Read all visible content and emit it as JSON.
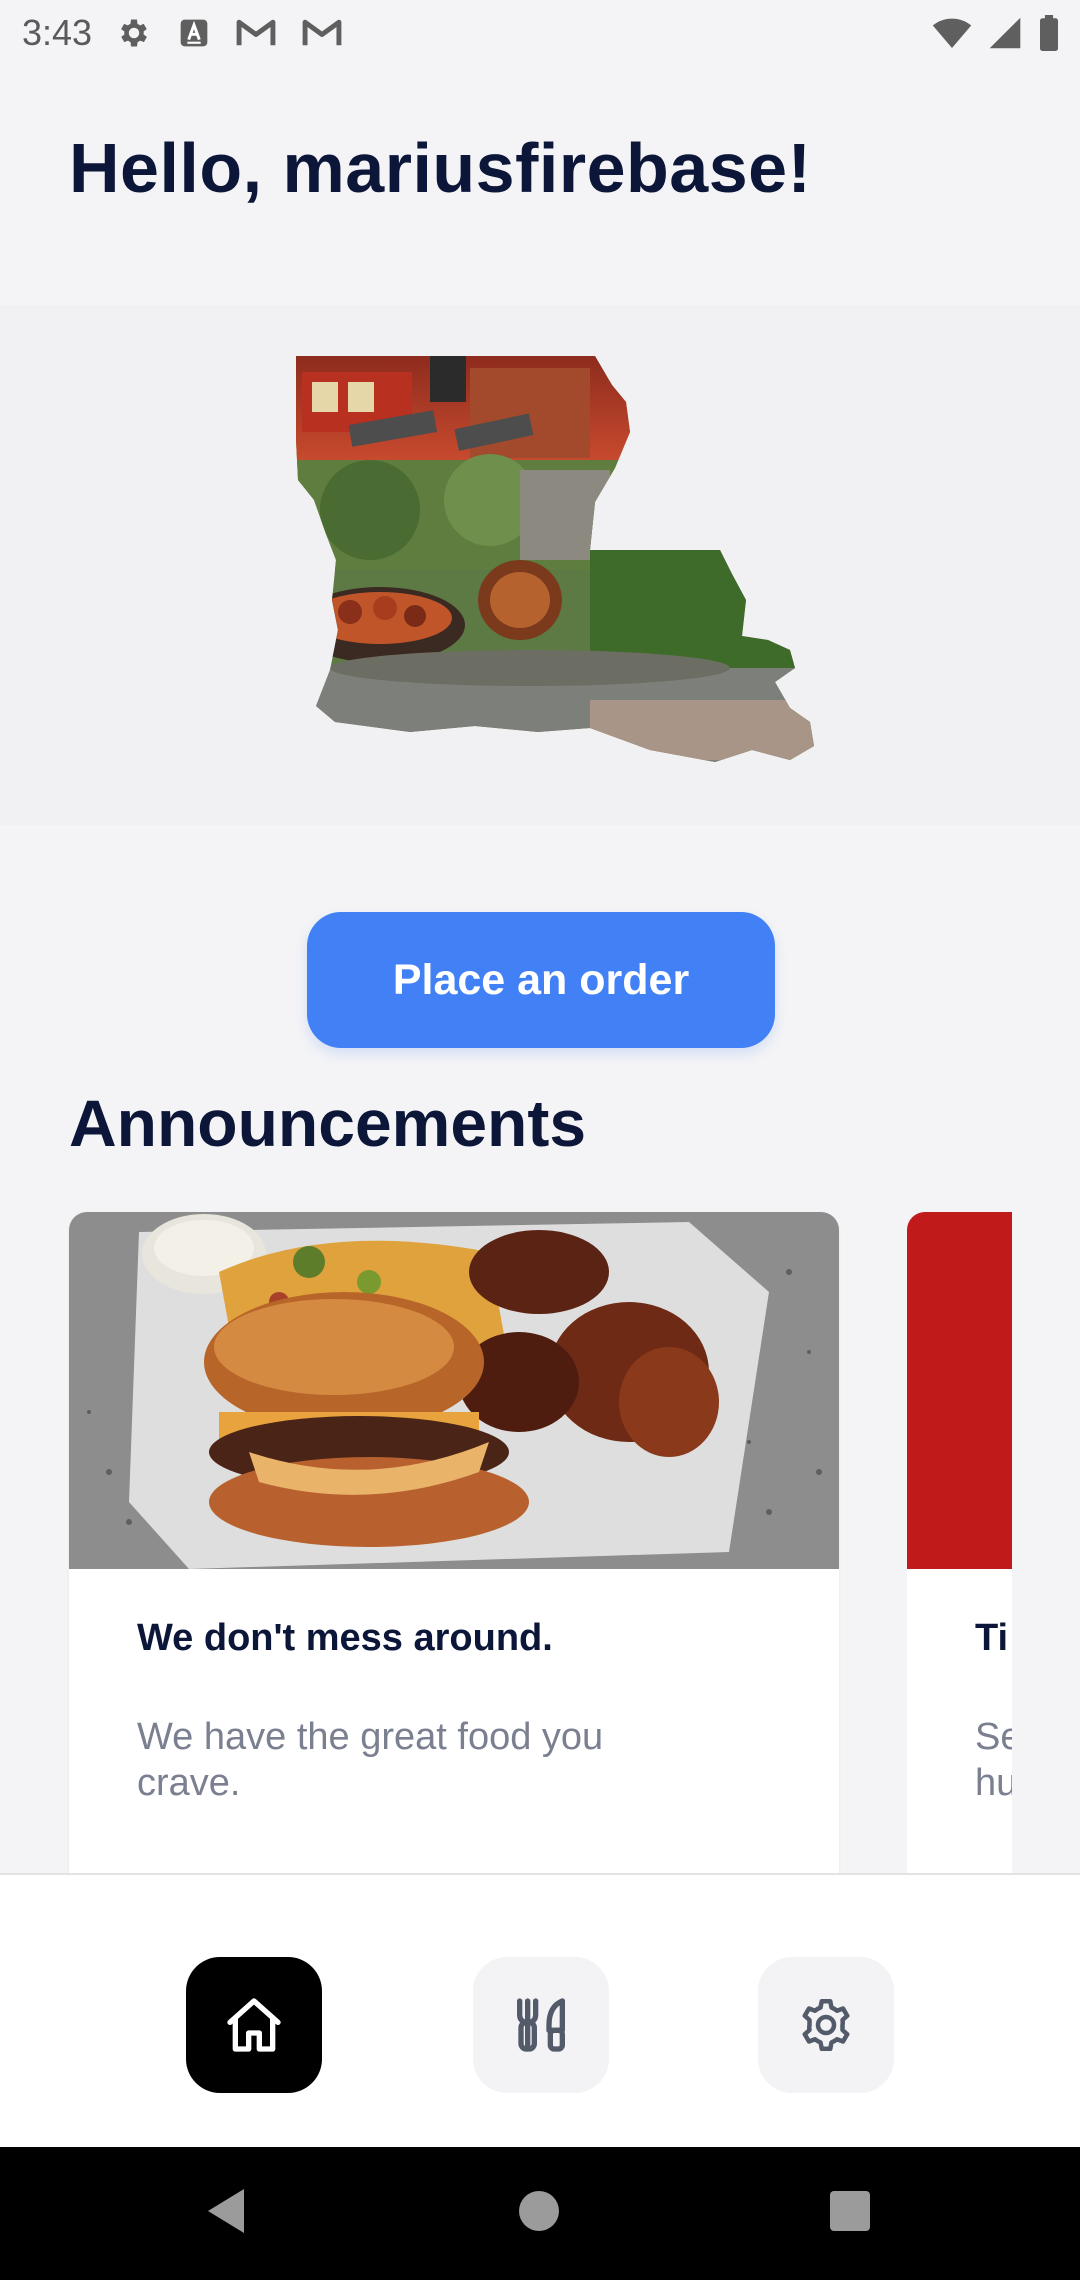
{
  "status_bar": {
    "time": "3:43",
    "left_icons": [
      "gear-icon",
      "a-box-icon",
      "gmail-icon",
      "gmail-icon"
    ],
    "right_icons": [
      "wifi-icon",
      "signal-icon",
      "battery-icon"
    ]
  },
  "header": {
    "greeting": "Hello, mariusfirebase!"
  },
  "hero": {
    "image": "louisiana-collage-image"
  },
  "actions": {
    "place_order_label": "Place an order"
  },
  "announcements": {
    "title": "Announcements",
    "cards": [
      {
        "image": "burger-and-wings-photo",
        "title": "We don't mess around.",
        "text": "We have the great food you crave."
      },
      {
        "image": "red-promo-photo",
        "title": "Ti",
        "text": "Se hu"
      }
    ]
  },
  "bottom_nav": {
    "items": [
      {
        "icon": "home-icon",
        "active": true
      },
      {
        "icon": "fork-knife-icon",
        "active": false
      },
      {
        "icon": "gear-icon",
        "active": false
      }
    ]
  },
  "system_nav": {
    "icons": [
      "back-icon",
      "home-circle-icon",
      "recents-icon"
    ]
  },
  "colors": {
    "primary": "#4281f5",
    "title_text": "#0c1638",
    "muted_text": "#7b8091",
    "active_nav": "#000000"
  }
}
